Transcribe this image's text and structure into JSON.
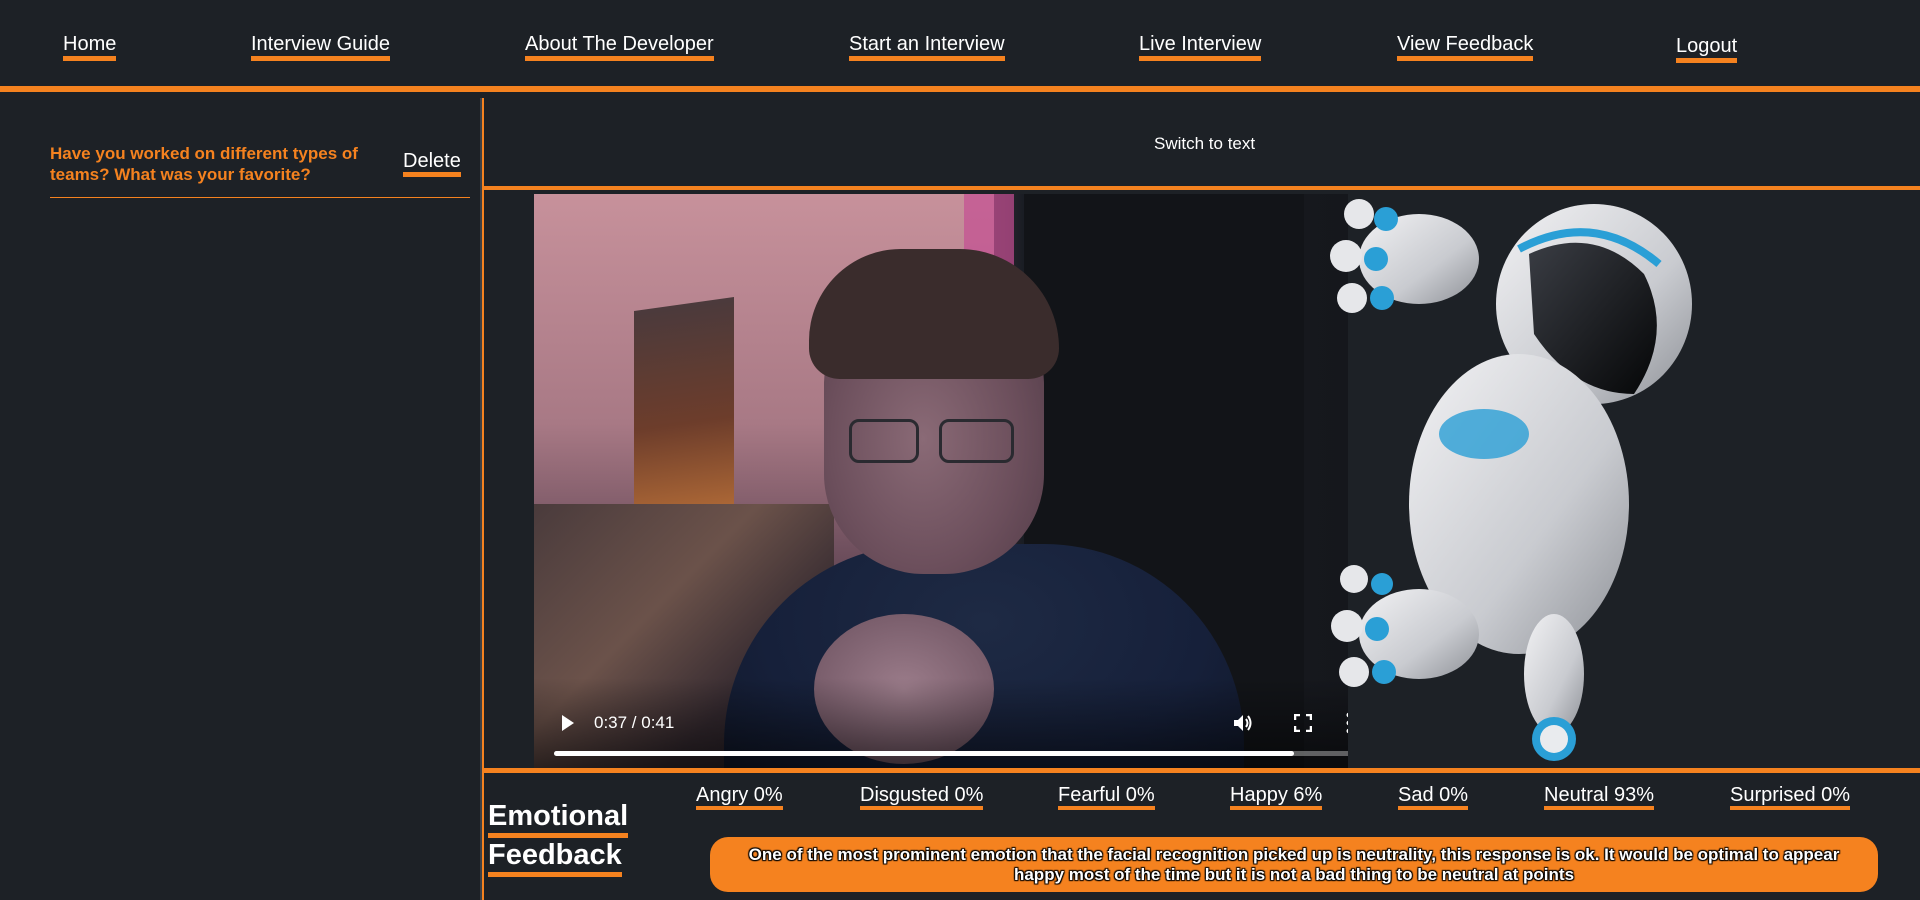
{
  "nav": {
    "items": [
      {
        "label": "Home"
      },
      {
        "label": "Interview Guide"
      },
      {
        "label": "About The Developer"
      },
      {
        "label": "Start an Interview"
      },
      {
        "label": "Live Interview"
      },
      {
        "label": "View Feedback"
      },
      {
        "label": "Logout"
      }
    ]
  },
  "sidebar": {
    "questions": [
      {
        "text": "Have you worked on different types of teams? What was your favorite?",
        "delete_label": "Delete"
      }
    ]
  },
  "main": {
    "switch_label": "Switch to text",
    "video": {
      "time": "0:37 / 0:41",
      "progress": 0.9
    },
    "feedback": {
      "title_line1": "Emotional",
      "title_line2": "Feedback",
      "emotions": [
        {
          "label": "Angry 0%"
        },
        {
          "label": "Disgusted 0%"
        },
        {
          "label": "Fearful 0%"
        },
        {
          "label": "Happy 6%"
        },
        {
          "label": "Sad 0%"
        },
        {
          "label": "Neutral 93%"
        },
        {
          "label": "Surprised 0%"
        }
      ],
      "message": "One of the most prominent emotion that the facial recognition picked up is neutrality, this response is ok. It would be optimal to appear happy most of the time but it is not a bad thing to be neutral at points"
    }
  },
  "colors": {
    "accent": "#f5821f",
    "background": "#1d2126"
  }
}
